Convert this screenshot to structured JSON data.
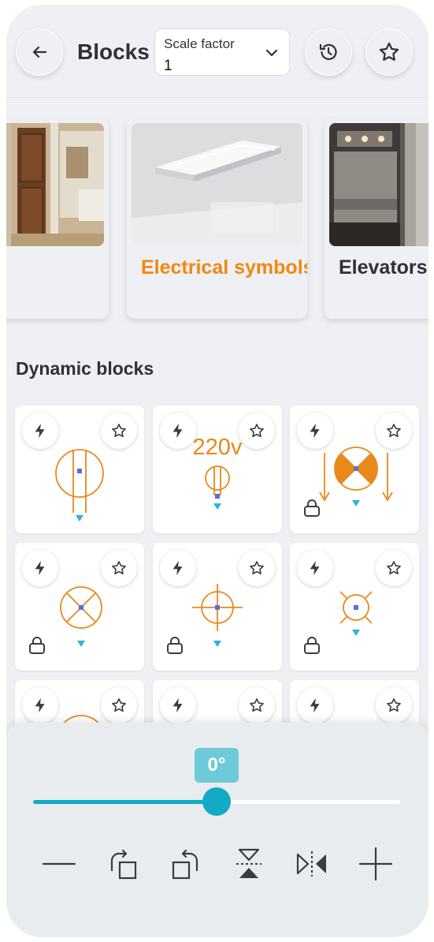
{
  "header": {
    "title": "Blocks",
    "back_icon": "arrow-left-icon",
    "scale_factor": {
      "label": "Scale factor",
      "value": "1"
    },
    "history_icon": "history-icon",
    "favorites_icon": "star-icon"
  },
  "categories": [
    {
      "label": "",
      "image": "doors-photo",
      "active": false
    },
    {
      "label": "Electrical symbols",
      "image": "ceiling-light-photo",
      "active": true
    },
    {
      "label": "Elevators",
      "image": "elevator-photo",
      "active": false
    }
  ],
  "section": {
    "title": "Dynamic blocks"
  },
  "blocks": [
    {
      "symbol": "lamp-pendant",
      "label": "",
      "locked": false
    },
    {
      "symbol": "lamp-220v",
      "label": "220v",
      "locked": false
    },
    {
      "symbol": "lamp-filled-bowtie",
      "label": "",
      "locked": true
    },
    {
      "symbol": "lamp-x-circle",
      "label": "",
      "locked": true
    },
    {
      "symbol": "lamp-crosshair",
      "label": "",
      "locked": true
    },
    {
      "symbol": "lamp-small-rays",
      "label": "",
      "locked": true
    },
    {
      "symbol": "lamp-partial-arc",
      "label": "",
      "locked": false
    },
    {
      "symbol": "lamp-partial-bar",
      "label": "",
      "locked": false
    },
    {
      "symbol": "lamp-partial-empty",
      "label": "",
      "locked": false
    }
  ],
  "rotation": {
    "angle_label": "0°",
    "slider_fraction": 0.5
  },
  "tools": [
    {
      "name": "line-tool",
      "icon": "horizontal-line-icon"
    },
    {
      "name": "rotate-cw-tool",
      "icon": "rotate-clockwise-icon"
    },
    {
      "name": "rotate-ccw-tool",
      "icon": "rotate-counterclockwise-icon"
    },
    {
      "name": "flip-vertical-tool",
      "icon": "flip-vertical-icon"
    },
    {
      "name": "flip-horizontal-tool",
      "icon": "flip-horizontal-icon"
    },
    {
      "name": "add-tool",
      "icon": "plus-icon"
    }
  ],
  "colors": {
    "accent_orange": "#f2870f",
    "accent_cyan": "#12aac5",
    "symbol_orange": "#e8891a",
    "marker_blue": "#5b6fdc"
  }
}
